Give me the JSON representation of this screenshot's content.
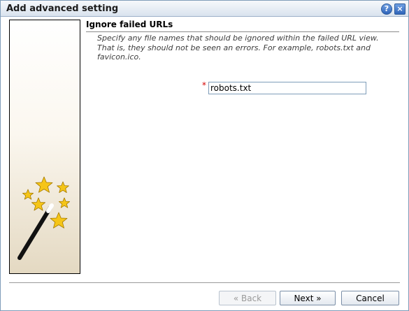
{
  "window": {
    "title": "Add advanced setting",
    "help_label": "?",
    "close_label": "×"
  },
  "section": {
    "title": "Ignore failed URLs",
    "description": "Specify any file names that should be ignored within the failed URL view. That is, they should not be seen an errors. For example, robots.txt and favicon.ico."
  },
  "field": {
    "required_mark": "*",
    "value": "robots.txt"
  },
  "buttons": {
    "back": "« Back",
    "next": "Next »",
    "cancel": "Cancel"
  },
  "colors": {
    "required": "#d40000",
    "titlebar": "#d9e3ee",
    "star": "#f5c518"
  },
  "icons": {
    "wizard": "magic-wand-with-stars-icon"
  }
}
